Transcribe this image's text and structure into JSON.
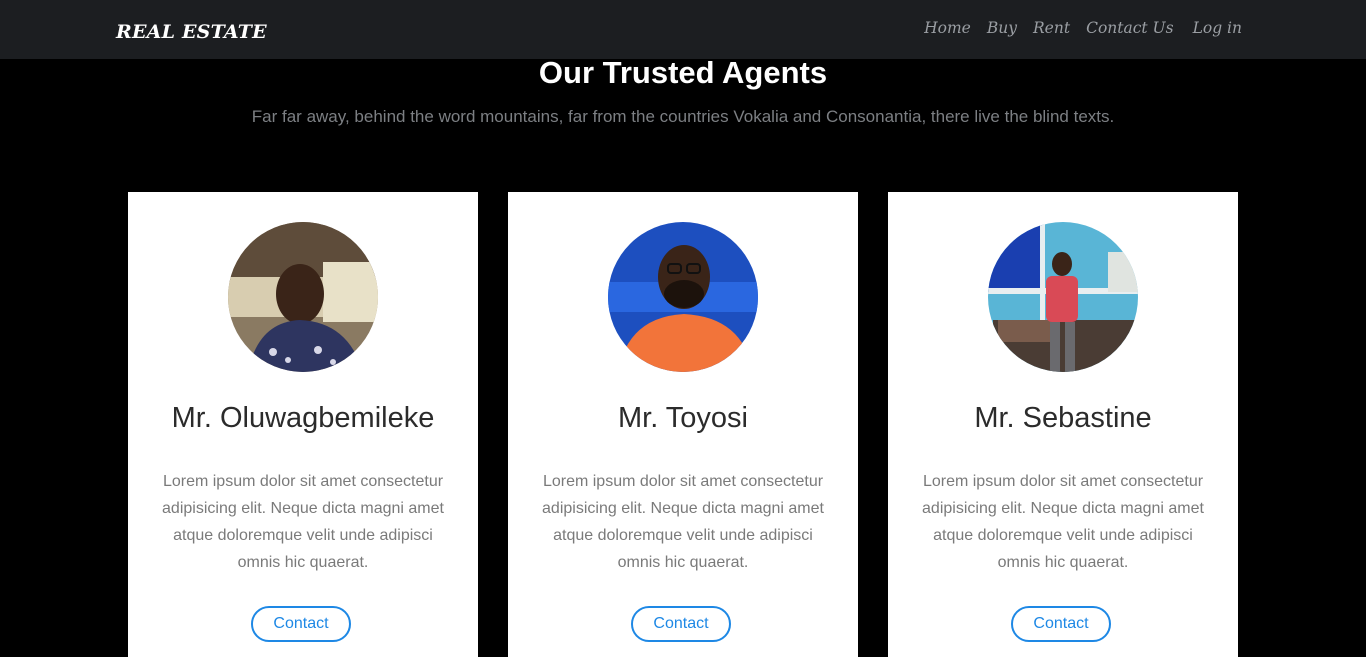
{
  "navbar": {
    "brand": "REAL ESTATE",
    "links": [
      "Home",
      "Buy",
      "Rent",
      "Contact Us",
      "Log in"
    ]
  },
  "section": {
    "title": "Our Trusted Agents",
    "subtitle": "Far far away, behind the word mountains, far from the countries Vokalia and Consonantia, there live the blind texts."
  },
  "agents": [
    {
      "name": "Mr. Oluwagbemileke",
      "description": "Lorem ipsum dolor sit amet consectetur adipisicing elit. Neque dicta magni amet atque doloremque velit unde adipisci omnis hic quaerat.",
      "button": "Contact"
    },
    {
      "name": "Mr. Toyosi",
      "description": "Lorem ipsum dolor sit amet consectetur adipisicing elit. Neque dicta magni amet atque doloremque velit unde adipisci omnis hic quaerat.",
      "button": "Contact"
    },
    {
      "name": "Mr. Sebastine",
      "description": "Lorem ipsum dolor sit amet consectetur adipisicing elit. Neque dicta magni amet atque doloremque velit unde adipisci omnis hic quaerat.",
      "button": "Contact"
    }
  ],
  "colors": {
    "navbar_bg": "#1c1e21",
    "page_bg": "#000000",
    "accent": "#1e88e5"
  }
}
